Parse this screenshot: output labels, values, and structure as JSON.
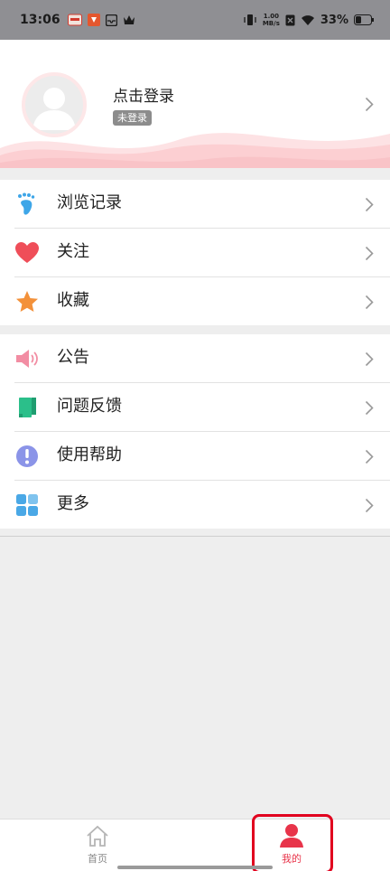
{
  "status_bar": {
    "time": "13:06",
    "net_speed_value": "1.00",
    "net_speed_unit": "MB/s",
    "battery_percent": "33%",
    "icons": [
      "notification-app-icon",
      "notification-app-icon-2",
      "inbox-icon",
      "crown-icon",
      "vibrate-icon",
      "sim-icon",
      "wifi-icon",
      "battery-icon"
    ]
  },
  "profile": {
    "title": "点击登录",
    "status_badge": "未登录"
  },
  "menu_group_1": {
    "items": [
      {
        "label": "浏览记录",
        "icon": "footprint-icon"
      },
      {
        "label": "关注",
        "icon": "heart-icon"
      },
      {
        "label": "收藏",
        "icon": "star-icon"
      }
    ]
  },
  "menu_group_2": {
    "items": [
      {
        "label": "公告",
        "icon": "speaker-icon"
      },
      {
        "label": "问题反馈",
        "icon": "feedback-book-icon"
      },
      {
        "label": "使用帮助",
        "icon": "help-exclamation-icon"
      },
      {
        "label": "更多",
        "icon": "grid-more-icon"
      }
    ]
  },
  "tab_bar": {
    "tabs": [
      {
        "label": "首页",
        "icon": "home-icon",
        "active": false
      },
      {
        "label": "我的",
        "icon": "person-icon",
        "active": true
      }
    ]
  },
  "colors": {
    "accent": "#e8344a",
    "highlight_box": "#e1001e",
    "status_bar_bg": "#8f8f93",
    "wave_pink": "#fccfd2"
  }
}
